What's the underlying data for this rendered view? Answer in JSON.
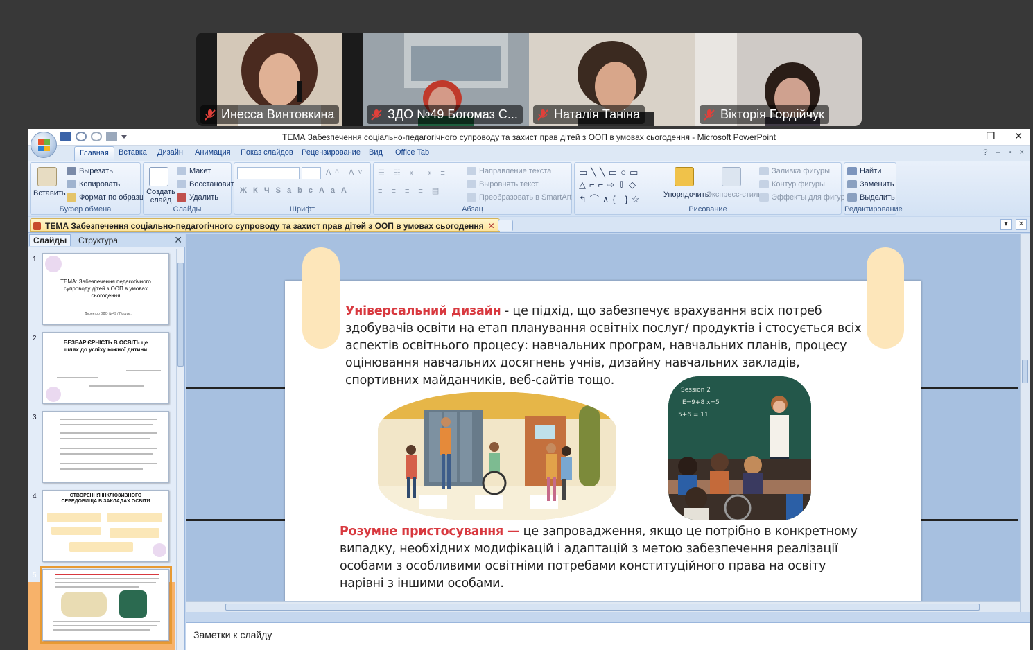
{
  "participants": [
    {
      "name": "Инесса Винтовкина",
      "color": "#c9b9a4",
      "skin": "#d9a98a",
      "hair": "#5a3424"
    },
    {
      "name": "ЗДО №49  Богомаз С...",
      "color": "#a7aeb3",
      "skin": "#d49a88",
      "hair": "#c0392b"
    },
    {
      "name": "Наталія Таніна",
      "color": "#d7cfc3",
      "skin": "#d8a68a",
      "hair": "#3b2a20"
    },
    {
      "name": "Вікторія Гордійчук",
      "color": "#cbc6c2",
      "skin": "#cfa18f",
      "hair": "#2a1d17"
    }
  ],
  "window": {
    "title": "ТЕМА Забезпечення соціально-педагогічного супроводу та захист прав дітей з ООП в умовах сьогодення  - Microsoft PowerPoint",
    "min": "—",
    "max": "❐",
    "close": "✕"
  },
  "ribbon_tabs": [
    "Главная",
    "Вставка",
    "Дизайн",
    "Анимация",
    "Показ слайдов",
    "Рецензирование",
    "Вид",
    "Office Tab"
  ],
  "ribbon": {
    "clipboard": {
      "paste": "Вставить",
      "cut": "Вырезать",
      "copy": "Копировать",
      "format": "Формат по образцу",
      "label": "Буфер обмена"
    },
    "slides": {
      "new": "Создать слайд",
      "layout": "Макет",
      "reset": "Восстановить",
      "delete": "Удалить",
      "label": "Слайды"
    },
    "font": {
      "label": "Шрифт"
    },
    "paragraph": {
      "direction": "Направление текста",
      "align": "Выровнять текст",
      "smartart": "Преобразовать в SmartArt",
      "label": "Абзац"
    },
    "drawing": {
      "arrange": "Упорядочить",
      "styles": "Экспресс-стили",
      "fill": "Заливка фигуры",
      "outline": "Контур фигуры",
      "effects": "Эффекты для фигур",
      "label": "Рисование"
    },
    "editing": {
      "find": "Найти",
      "replace": "Заменить",
      "select": "Выделить",
      "label": "Редактирование"
    }
  },
  "doc_tab": {
    "title": "ТЕМА Забезпечення соціально-педагогічного супроводу та захист прав дітей з ООП в умовах сьогодення",
    "close": "✕"
  },
  "pane": {
    "tab_slides": "Слайды",
    "tab_outline": "Структура",
    "close": "✕"
  },
  "thumbs": [
    {
      "num": "1",
      "title": "ТЕМА: Забезпечення педагогічного супроводу  дітей з ООП в умовах сьогодення",
      "sub": "Директор ЗДО №49 / Пошук..."
    },
    {
      "num": "2",
      "title": "БЕЗБАР'ЄРНІСТЬ В ОСВІТІ- це шлях до успіху кожної дитини"
    },
    {
      "num": "3",
      "title": ""
    },
    {
      "num": "4",
      "title": "СТВОРЕННЯ ІНКЛЮЗИВНОГО СЕРЕДОВИЩА В ЗАКЛАДАХ ОСВІТИ"
    },
    {
      "num": "5",
      "title": ""
    }
  ],
  "slide": {
    "p1_kw": "Універсальний дизайн",
    "p1_text": " - це підхід, що забезпечує врахування всіх потреб здобувачів освіти на етап планування освітніх послуг/ продуктів і стосується всіх аспектів освітнього процесу: навчальних програм, навчальних планів, процесу оцінювання навчальних досягнень учнів, дизайну навчальних закладів, спортивних майданчиків, веб-сайтів тощо.",
    "p2_kw": "Розумне пристосування —",
    "p2_text": " це запровадження, якщо це потрібно в конкретному випадку, необхідних модифікацій і адаптацій з метою забезпечення реалізації особами з особливими освітніми потребами конституційного права на освіту нарівні з іншими особами."
  },
  "notes": {
    "placeholder": "Заметки к слайду"
  },
  "colors": {
    "accent_red": "#d8393f",
    "pill": "#fde6ba",
    "selection": "#f7b26a"
  }
}
